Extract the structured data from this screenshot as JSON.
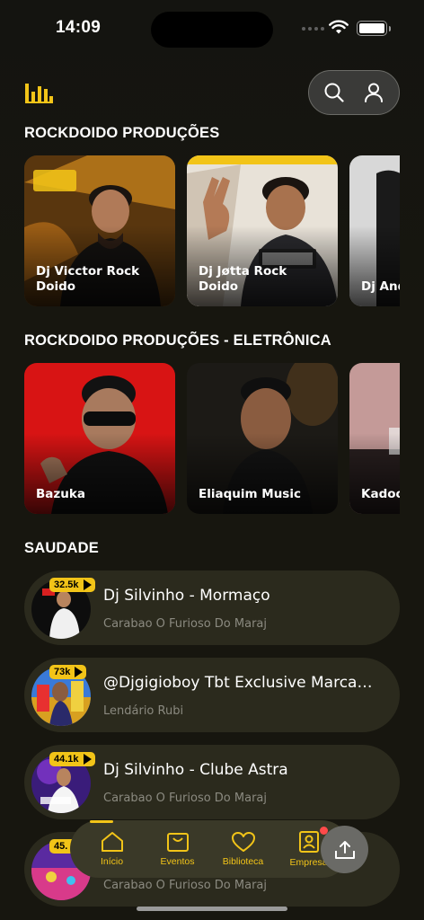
{
  "status_bar": {
    "time": "14:09"
  },
  "sections": [
    {
      "title": "ROCKDOIDO PRODUÇÕES",
      "cards": [
        {
          "label": "Dj Vicctor Rock\nDoido"
        },
        {
          "label": "Dj Jøtta Rock\nDoido"
        },
        {
          "label": "Dj And"
        }
      ]
    },
    {
      "title": "ROCKDOIDO PRODUÇÕES - ELETRÔNICA",
      "cards": [
        {
          "label": "Bazuka"
        },
        {
          "label": "Eliaquim Music"
        },
        {
          "label": "Kadoo"
        }
      ]
    },
    {
      "title": "SAUDADE"
    }
  ],
  "tracks": [
    {
      "badge": "32.5k",
      "title": "Dj Silvinho - Mormaço",
      "artist": "Carabao O Furioso Do Maraj"
    },
    {
      "badge": "73k",
      "title": "@Djgigioboy Tbt Exclusive Marcante...",
      "artist": "Lendário Rubi"
    },
    {
      "badge": "44.1k",
      "title": "Dj Silvinho - Clube Astra",
      "artist": "Carabao O Furioso Do Maraj"
    },
    {
      "badge": "45.",
      "title": "",
      "artist": "Carabao O Furioso Do Maraj"
    }
  ],
  "tabs": [
    {
      "label": "Início",
      "icon": "home-icon"
    },
    {
      "label": "Eventos",
      "icon": "ticket-icon"
    },
    {
      "label": "Biblioteca",
      "icon": "heart-icon"
    },
    {
      "label": "Empresa",
      "icon": "badge-icon"
    }
  ],
  "colors": {
    "accent": "#f2c418",
    "background": "#17160f",
    "card": "#2b2a1d",
    "notification": "#ff4a4a"
  }
}
